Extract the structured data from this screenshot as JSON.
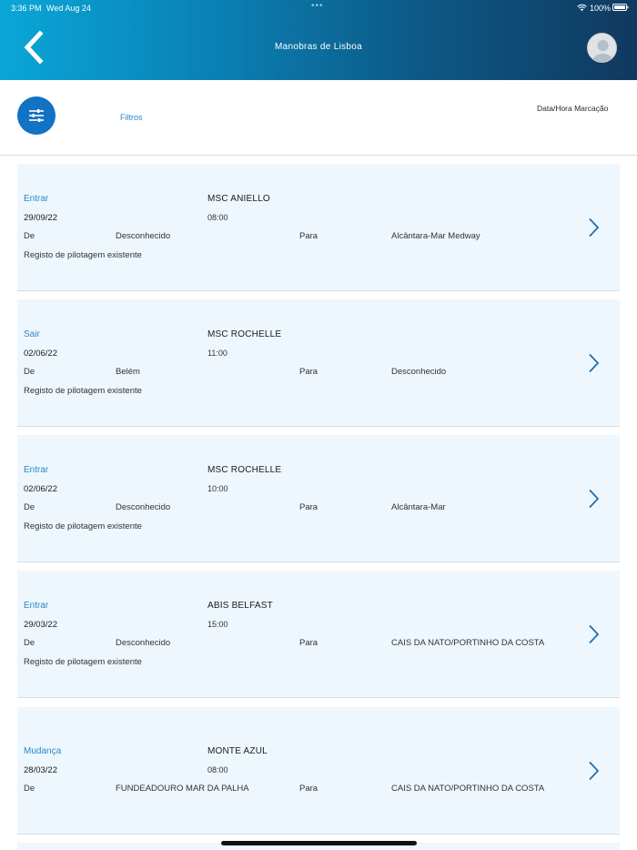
{
  "status_bar": {
    "time": "3:36 PM",
    "date": "Wed Aug 24",
    "dots": "•••",
    "battery": "100%",
    "wifi_icon": "wifi-icon",
    "battery_icon": "battery-icon"
  },
  "header": {
    "title": "Manobras de Lisboa",
    "back_icon": "chevron-left-icon",
    "avatar_icon": "user-avatar-icon",
    "gradient_start": "#0aa6d8",
    "gradient_end": "#10395f"
  },
  "filters": {
    "button_icon": "sliders-icon",
    "label": "Filtros",
    "sort_value": "Data/Hora Marcação",
    "accent": "#1272c3"
  },
  "labels": {
    "from": "De",
    "to": "Para"
  },
  "maneuvers": [
    {
      "type": "Entrar",
      "ship": "MSC ANIELLO",
      "date": "29/09/22",
      "time": "08:00",
      "from": "Desconhecido",
      "to": "Alcântara-Mar Medway",
      "note": "Registo de pilotagem existente"
    },
    {
      "type": "Sair",
      "ship": "MSC ROCHELLE",
      "date": "02/06/22",
      "time": "11:00",
      "from": "Belém",
      "to": "Desconhecido",
      "note": "Registo de pilotagem existente"
    },
    {
      "type": "Entrar",
      "ship": "MSC ROCHELLE",
      "date": "02/06/22",
      "time": "10:00",
      "from": "Desconhecido",
      "to": "Alcântara-Mar",
      "note": "Registo de pilotagem existente"
    },
    {
      "type": "Entrar",
      "ship": "ABIS BELFAST",
      "date": "29/03/22",
      "time": "15:00",
      "from": "Desconhecido",
      "to": "CAIS DA NATO/PORTINHO DA COSTA",
      "note": "Registo de pilotagem existente"
    },
    {
      "type": "Mudança",
      "ship": "MONTE AZUL",
      "date": "28/03/22",
      "time": "08:00",
      "from": "FUNDEADOURO MAR DA PALHA",
      "to": "CAIS DA NATO/PORTINHO DA COSTA",
      "note": ""
    }
  ]
}
